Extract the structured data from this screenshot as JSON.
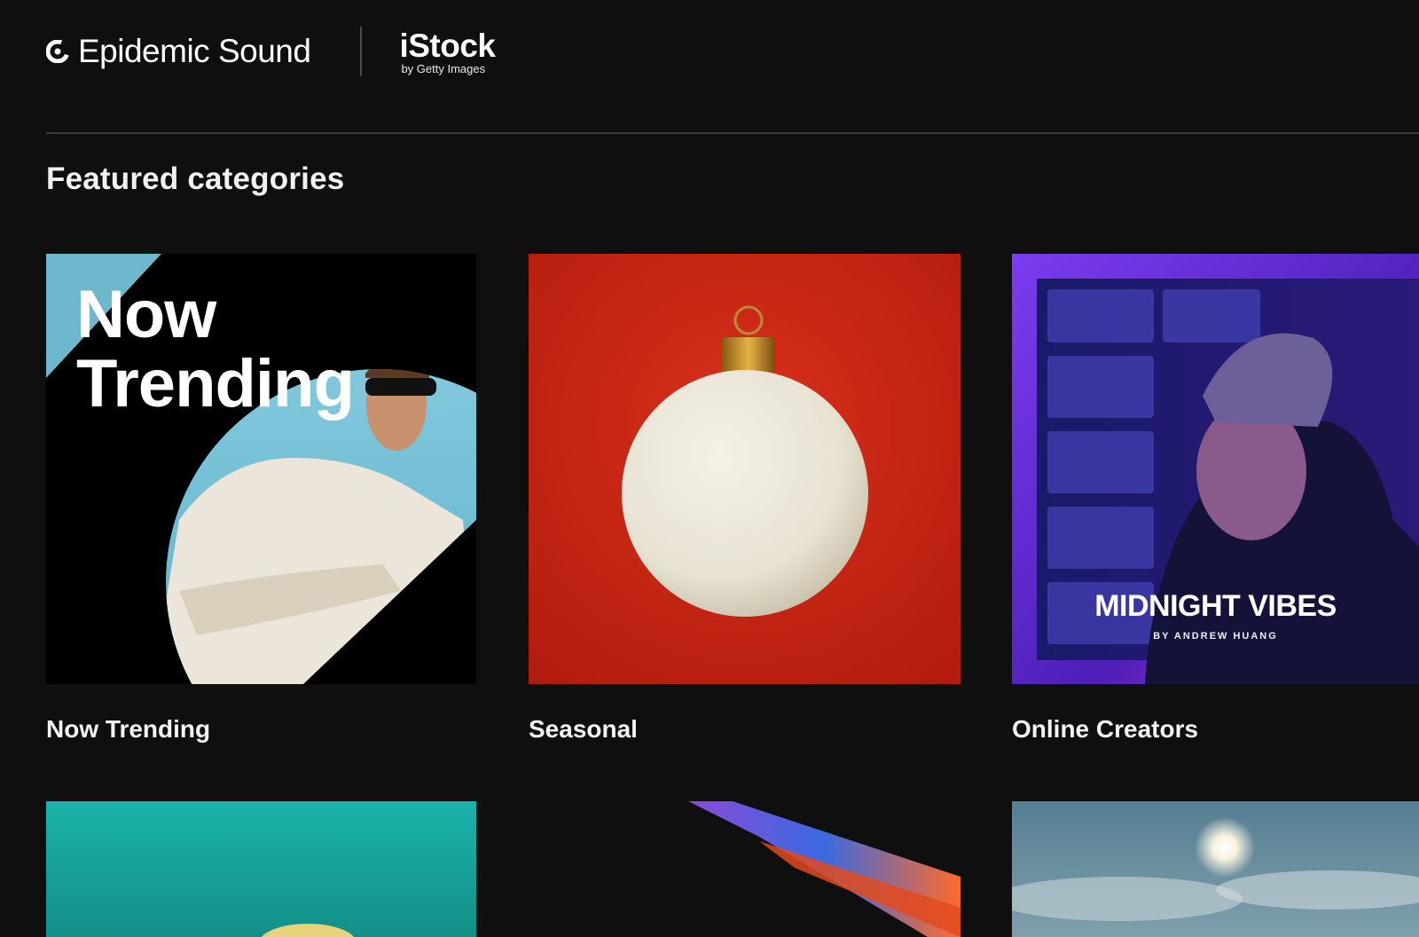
{
  "header": {
    "brand": "Epidemic Sound",
    "partner": {
      "name": "iStock",
      "sub": "by Getty Images"
    }
  },
  "section": {
    "title": "Featured categories"
  },
  "cards": [
    {
      "label": "Now Trending",
      "overlay_text": "Now\nTrending"
    },
    {
      "label": "Seasonal"
    },
    {
      "label": "Online Creators",
      "overlay_title": "MIDNIGHT VIBES",
      "overlay_sub": "BY ANDREW HUANG"
    },
    {
      "label": ""
    },
    {
      "label": ""
    },
    {
      "label": ""
    }
  ],
  "colors": {
    "background": "#0f0f0f",
    "text": "#ffffff",
    "seasonal_red": "#c41f0f",
    "trending_blue": "#7cc3d6",
    "teal": "#19aca4"
  },
  "icons": [
    "epidemic-sound-logo-icon"
  ]
}
